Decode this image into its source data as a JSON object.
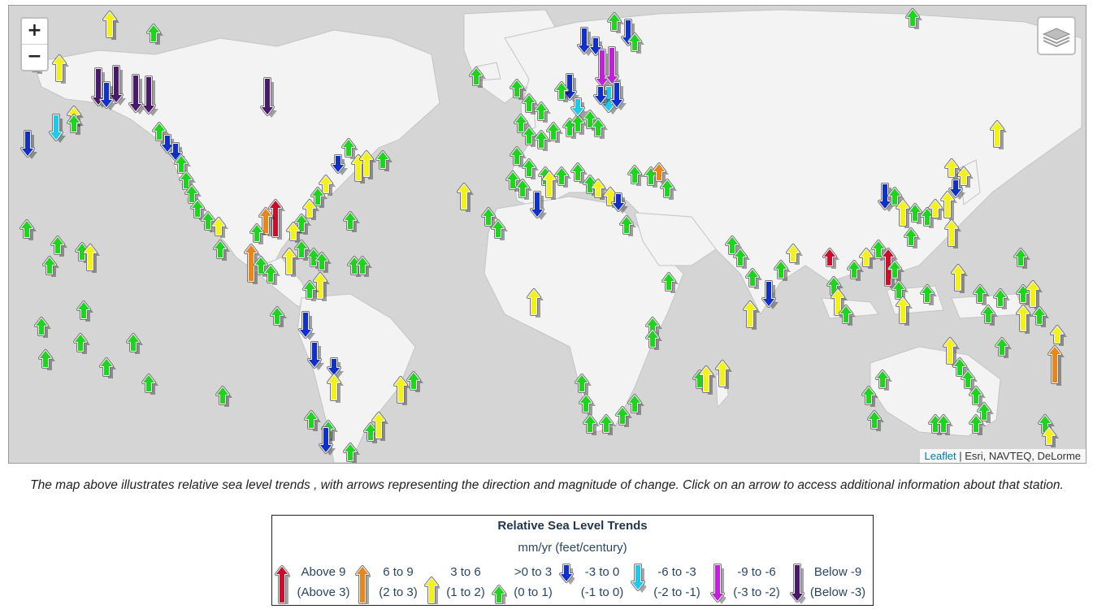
{
  "map": {
    "zoom_in": "+",
    "zoom_out": "−",
    "layers_icon": "layers-icon",
    "attribution_link": "Leaflet",
    "attribution_text": "| Esri, NAVTEQ, DeLorme"
  },
  "caption": "The map above illustrates relative sea level trends , with arrows representing the direction and magnitude of change. Click on an arrow to access additional information about that station.",
  "legend": {
    "title": "Relative Sea Level Trends",
    "subtitle": "mm/yr (feet/century)",
    "items": [
      {
        "line1": "Above 9",
        "line2": "(Above 3)",
        "color": "#c8102e",
        "dir": "up",
        "size": "big"
      },
      {
        "line1": "6 to 9",
        "line2": "(2 to 3)",
        "color": "#e8861a",
        "dir": "up",
        "size": "big"
      },
      {
        "line1": "3 to 6",
        "line2": "(1 to 2)",
        "color": "#f2f21a",
        "dir": "up",
        "size": "mid"
      },
      {
        "line1": ">0 to 3",
        "line2": "(0 to 1)",
        "color": "#1ed41e",
        "dir": "up",
        "size": "small"
      },
      {
        "line1": "-3 to 0",
        "line2": "(-1 to 0)",
        "color": "#1030c8",
        "dir": "down",
        "size": "small"
      },
      {
        "line1": "-6 to -3",
        "line2": "(-2 to -1)",
        "color": "#22c8e8",
        "dir": "down",
        "size": "mid"
      },
      {
        "line1": "-9 to -6",
        "line2": "(-3 to -2)",
        "color": "#c020d8",
        "dir": "down",
        "size": "big"
      },
      {
        "line1": "Below -9",
        "line2": "(Below -3)",
        "color": "#4a1a6a",
        "dir": "down",
        "size": "big"
      }
    ]
  }
}
